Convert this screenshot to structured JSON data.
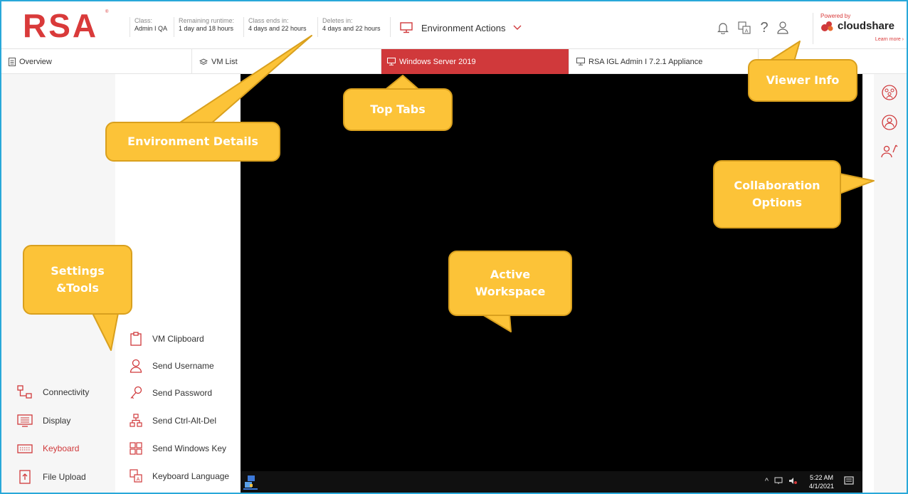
{
  "header": {
    "logo": "RSA",
    "logo_tm": "®",
    "info": [
      {
        "label": "Class:",
        "value": "Admin I QA"
      },
      {
        "label": "Remaining runtime:",
        "value": "1 day and 18 hours"
      },
      {
        "label": "Class ends in:",
        "value": "4 days and 22 hours"
      },
      {
        "label": "Deletes in:",
        "value": "4 days and 22 hours"
      }
    ],
    "environment_actions": "Environment Actions",
    "powered_by": "Powered by",
    "brand": "cloudshare",
    "learn_more": "Learn more ›"
  },
  "tabs": [
    {
      "label": "Overview",
      "icon": "document-icon"
    },
    {
      "label": "VM List",
      "icon": "layers-icon"
    },
    {
      "label": "Windows Server 2019",
      "icon": "monitor-icon",
      "active": true
    },
    {
      "label": "RSA IGL Admin I 7.2.1 Appliance",
      "icon": "monitor-icon"
    }
  ],
  "left_menu": [
    {
      "label": "Connectivity",
      "icon": "connectivity-icon"
    },
    {
      "label": "Display",
      "icon": "display-icon"
    },
    {
      "label": "Keyboard",
      "icon": "keyboard-icon",
      "selected": true
    },
    {
      "label": "File Upload",
      "icon": "file-upload-icon"
    }
  ],
  "submenu": [
    {
      "label": "VM Clipboard",
      "icon": "clipboard-icon"
    },
    {
      "label": "Send Username",
      "icon": "user-icon"
    },
    {
      "label": "Send Password",
      "icon": "key-icon"
    },
    {
      "label": "Send Ctrl-Alt-Del",
      "icon": "network-icon"
    },
    {
      "label": "Send Windows Key",
      "icon": "windows-icon"
    },
    {
      "label": "Keyboard Language",
      "icon": "language-icon"
    }
  ],
  "taskbar": {
    "time": "5:22 AM",
    "date": "4/1/2021",
    "tray": "^"
  },
  "callouts": {
    "environment_details": "Environment Details",
    "top_tabs": "Top Tabs",
    "viewer_info": "Viewer Info",
    "collaboration_line1": "Collaboration",
    "collaboration_line2": "Options",
    "settings_line1": "Settings",
    "settings_line2": "&Tools",
    "workspace_line1": "Active",
    "workspace_line2": "Workspace"
  },
  "colors": {
    "accent": "#d0393b",
    "callout": "#fcc338",
    "frame": "#29a8d9"
  }
}
